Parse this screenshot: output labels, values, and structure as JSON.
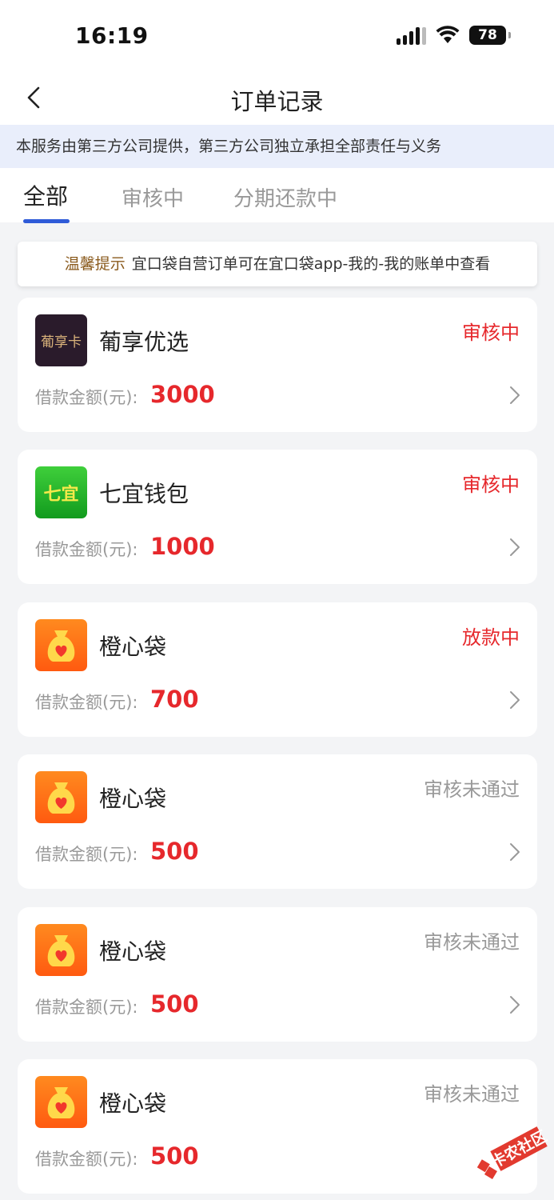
{
  "status_bar": {
    "time": "16:19",
    "battery": "78"
  },
  "nav": {
    "title": "订单记录"
  },
  "notice": "本服务由第三方公司提供，第三方公司独立承担全部责任与义务",
  "tabs": [
    {
      "label": "全部"
    },
    {
      "label": "审核中"
    },
    {
      "label": "分期还款中"
    }
  ],
  "tip": {
    "label": "温馨提示",
    "text": "宜口袋自营订单可在宜口袋app-我的-我的账单中查看"
  },
  "amount_label": "借款金额(元):",
  "orders": [
    {
      "name": "葡享优选",
      "logo_text": "葡享卡",
      "status": "审核中",
      "amount": "3000"
    },
    {
      "name": "七宜钱包",
      "logo_text": "七宜",
      "status": "审核中",
      "amount": "1000"
    },
    {
      "name": "橙心袋",
      "status": "放款中",
      "amount": "700"
    },
    {
      "name": "橙心袋",
      "status": "审核未通过",
      "amount": "500"
    },
    {
      "name": "橙心袋",
      "status": "审核未通过",
      "amount": "500"
    },
    {
      "name": "橙心袋",
      "status": "审核未通过",
      "amount": "500"
    }
  ],
  "watermark_text": "卡农社区",
  "colors": {
    "accent_blue": "#2f5bd8",
    "status_red": "#e6282c",
    "notice_bg": "#e9eefb"
  }
}
